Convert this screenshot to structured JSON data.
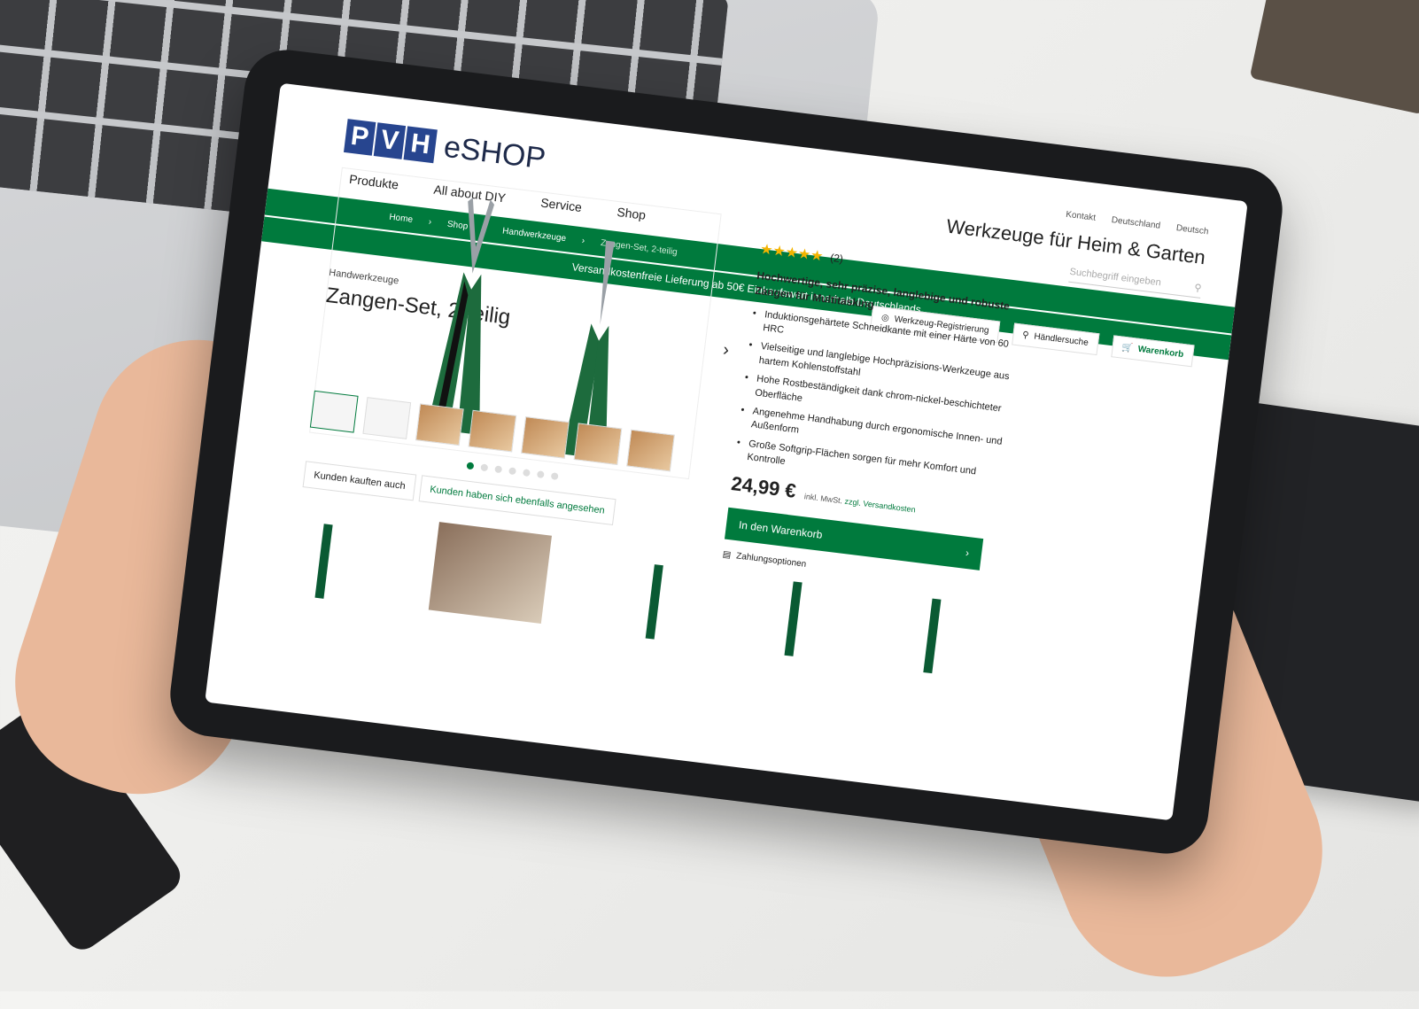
{
  "header": {
    "logo_badge": [
      "P",
      "V",
      "H"
    ],
    "logo_text": "eSHOP",
    "nav": [
      "Produkte",
      "All about DIY",
      "Service",
      "Shop"
    ],
    "top_links": [
      "Kontakt",
      "Deutschland",
      "Deutsch"
    ],
    "tagline": "Werkzeuge für Heim & Garten",
    "search_placeholder": "Suchbegriff eingeben"
  },
  "breadcrumb": [
    "Home",
    "Shop",
    "Handwerkzeuge",
    "Zangen-Set, 2-teilig"
  ],
  "promo": "Versandkostenfreie Lieferung ab 50€ Einkaufswert innerhalb Deutschlands",
  "utility": {
    "registration": "Werkzeug-Registrierung",
    "dealer": "Händlersuche",
    "cart": "Warenkorb"
  },
  "product": {
    "category": "Handwerkzeuge",
    "title": "Zangen-Set, 2-teilig",
    "stars": "★★★★★",
    "review_count": "(2)",
    "headline": "Hochwertige, sehr präzise, langlebige und robuste Zangen für Multitasking",
    "bullets": [
      "Induktionsgehärtete Schneidkante mit einer Härte von 60 HRC",
      "Vielseitige und langlebige Hochpräzisions-Werkzeuge aus hartem Kohlenstoffstahl",
      "Hohe Rostbeständigkeit dank chrom-nickel-beschichteter Oberfläche",
      "Angenehme Handhabung durch ergonomische Innen- und Außenform",
      "Große Softgrip-Flächen sorgen für mehr Komfort und Kontrolle"
    ],
    "price": "24,99 €",
    "tax": "inkl. MwSt.",
    "shipping": "zzgl. Versandkosten",
    "cta": "In den Warenkorb",
    "payment": "Zahlungsoptionen"
  },
  "tabs": [
    "Kunden kauften auch",
    "Kunden haben sich ebenfalls angesehen"
  ],
  "colors": {
    "brand_green": "#007a3d",
    "logo_blue": "#27458f",
    "star": "#f3b400"
  }
}
